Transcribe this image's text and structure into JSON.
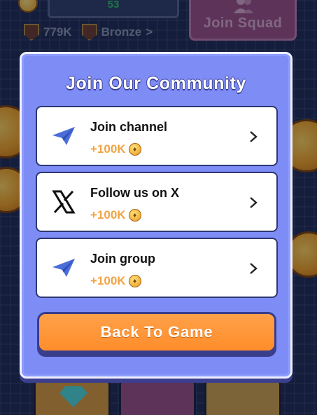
{
  "header": {
    "score": "53",
    "balance": "779K",
    "rank": "Bronze",
    "rank_chevron": ">",
    "join_squad_label": "Join Squad"
  },
  "modal": {
    "title": "Join Our Community",
    "tasks": [
      {
        "label": "Join channel",
        "reward": "+100K",
        "icon": "telegram-icon"
      },
      {
        "label": "Follow us on X",
        "reward": "+100K",
        "icon": "x-logo-icon"
      },
      {
        "label": "Join group",
        "reward": "+100K",
        "icon": "telegram-icon"
      }
    ],
    "back_label": "Back To Game"
  },
  "colors": {
    "modal_bg": "#7e8cf6",
    "reward": "#f0a443",
    "button": "#ff8d2a",
    "telegram": "#4a6dd8"
  }
}
